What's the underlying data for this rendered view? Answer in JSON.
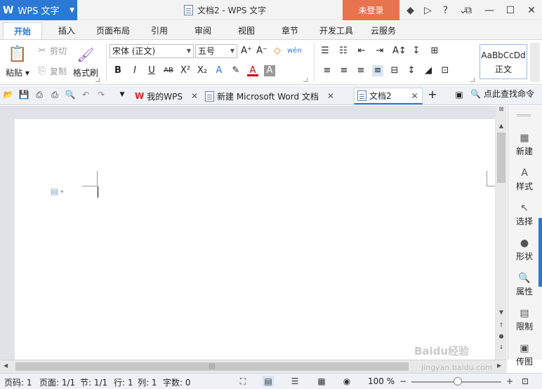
{
  "app": {
    "name": "WPS 文字",
    "window_title": "文档2 - WPS 文字",
    "login_label": "未登录"
  },
  "menu": {
    "tabs": [
      "开始",
      "插入",
      "页面布局",
      "引用",
      "审阅",
      "视图",
      "章节",
      "开发工具",
      "云服务"
    ],
    "active": "开始"
  },
  "ribbon": {
    "paste": "粘贴",
    "cut": "剪切",
    "copy": "复制",
    "format_painter": "格式刷",
    "font_name": "宋体 (正文)",
    "font_size": "五号",
    "style_preview": "AaBbCcDd",
    "style_name": "正文"
  },
  "doc_tabs": [
    {
      "label": "我的WPS"
    },
    {
      "label": "新建 Microsoft Word 文档"
    },
    {
      "label": "文档2",
      "active": true
    }
  ],
  "search_command": "点此查找命令",
  "side_panel": [
    "新建",
    "样式",
    "选择",
    "形状",
    "属性",
    "限制",
    "传图"
  ],
  "status": {
    "page_no": "页码: 1",
    "pages": "页面: 1/1",
    "section": "节: 1/1",
    "row": "行: 1",
    "col": "列: 1",
    "words": "字数: 0",
    "zoom": "100 %"
  },
  "watermark": {
    "brand": "Baidu经验",
    "url": "jingyan.baidu.com"
  },
  "icons": {
    "accent": "#2b79d3",
    "login_bg": "#e8734f"
  }
}
